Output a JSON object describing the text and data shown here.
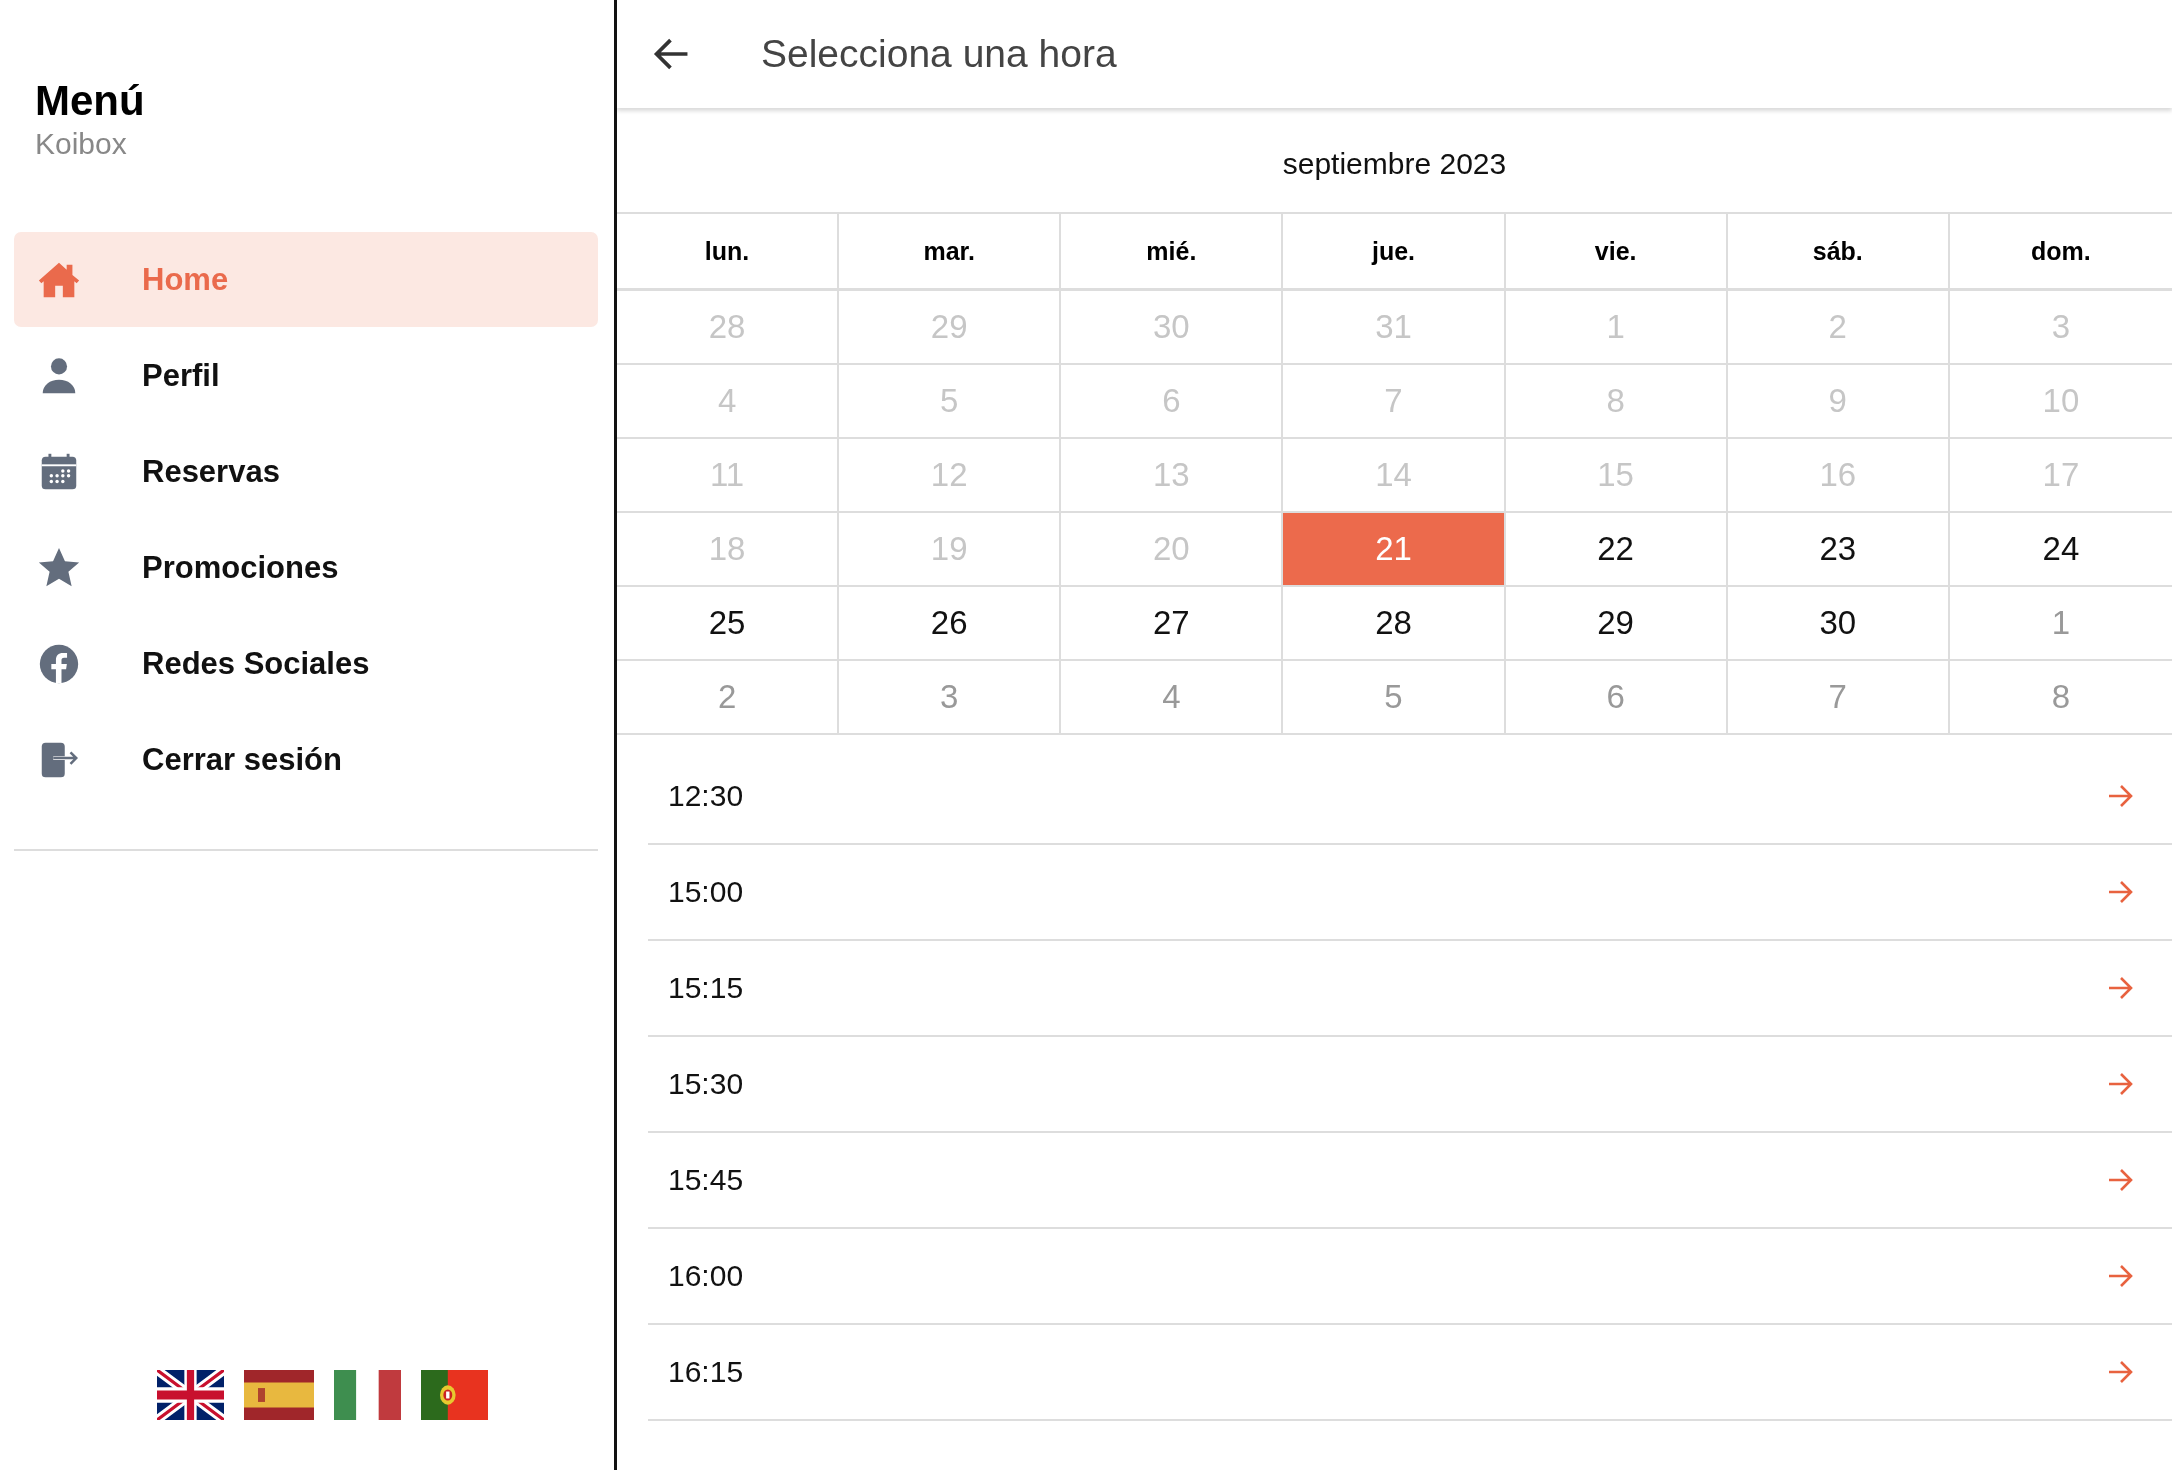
{
  "sidebar": {
    "title": "Menú",
    "subtitle": "Koibox",
    "items": [
      {
        "label": "Home",
        "selected": true
      },
      {
        "label": "Perfil",
        "selected": false
      },
      {
        "label": "Reservas",
        "selected": false
      },
      {
        "label": "Promociones",
        "selected": false
      },
      {
        "label": "Redes Sociales",
        "selected": false
      },
      {
        "label": "Cerrar sesión",
        "selected": false
      }
    ],
    "flags": [
      {
        "kind": "gb"
      },
      {
        "kind": "es"
      },
      {
        "kind": "it"
      },
      {
        "kind": "pt"
      }
    ]
  },
  "header": {
    "title": "Selecciona una hora"
  },
  "calendar": {
    "month": "septiembre 2023",
    "weekdays": [
      "lun.",
      "mar.",
      "mié.",
      "jue.",
      "vie.",
      "sáb.",
      "dom."
    ],
    "weeks": [
      [
        {
          "day": "28",
          "kind": "past",
          "selected": false
        },
        {
          "day": "29",
          "kind": "past",
          "selected": false
        },
        {
          "day": "30",
          "kind": "past",
          "selected": false
        },
        {
          "day": "31",
          "kind": "past",
          "selected": false
        },
        {
          "day": "1",
          "kind": "past",
          "selected": false
        },
        {
          "day": "2",
          "kind": "past",
          "selected": false
        },
        {
          "day": "3",
          "kind": "past",
          "selected": false
        }
      ],
      [
        {
          "day": "4",
          "kind": "past",
          "selected": false
        },
        {
          "day": "5",
          "kind": "past",
          "selected": false
        },
        {
          "day": "6",
          "kind": "past",
          "selected": false
        },
        {
          "day": "7",
          "kind": "past",
          "selected": false
        },
        {
          "day": "8",
          "kind": "past",
          "selected": false
        },
        {
          "day": "9",
          "kind": "past",
          "selected": false
        },
        {
          "day": "10",
          "kind": "past",
          "selected": false
        }
      ],
      [
        {
          "day": "11",
          "kind": "past",
          "selected": false
        },
        {
          "day": "12",
          "kind": "past",
          "selected": false
        },
        {
          "day": "13",
          "kind": "past",
          "selected": false
        },
        {
          "day": "14",
          "kind": "past",
          "selected": false
        },
        {
          "day": "15",
          "kind": "past",
          "selected": false
        },
        {
          "day": "16",
          "kind": "past",
          "selected": false
        },
        {
          "day": "17",
          "kind": "past",
          "selected": false
        }
      ],
      [
        {
          "day": "18",
          "kind": "past",
          "selected": false
        },
        {
          "day": "19",
          "kind": "past",
          "selected": false
        },
        {
          "day": "20",
          "kind": "past",
          "selected": false
        },
        {
          "day": "21",
          "kind": "available",
          "selected": true
        },
        {
          "day": "22",
          "kind": "available",
          "selected": false
        },
        {
          "day": "23",
          "kind": "available",
          "selected": false
        },
        {
          "day": "24",
          "kind": "available",
          "selected": false
        }
      ],
      [
        {
          "day": "25",
          "kind": "available",
          "selected": false
        },
        {
          "day": "26",
          "kind": "available",
          "selected": false
        },
        {
          "day": "27",
          "kind": "available",
          "selected": false
        },
        {
          "day": "28",
          "kind": "available",
          "selected": false
        },
        {
          "day": "29",
          "kind": "available",
          "selected": false
        },
        {
          "day": "30",
          "kind": "available",
          "selected": false
        },
        {
          "day": "1",
          "kind": "next",
          "selected": false
        }
      ],
      [
        {
          "day": "2",
          "kind": "next",
          "selected": false
        },
        {
          "day": "3",
          "kind": "next",
          "selected": false
        },
        {
          "day": "4",
          "kind": "next",
          "selected": false
        },
        {
          "day": "5",
          "kind": "next",
          "selected": false
        },
        {
          "day": "6",
          "kind": "next",
          "selected": false
        },
        {
          "day": "7",
          "kind": "next",
          "selected": false
        },
        {
          "day": "8",
          "kind": "next",
          "selected": false
        }
      ]
    ]
  },
  "times": [
    "12:30",
    "15:00",
    "15:15",
    "15:30",
    "15:45",
    "16:00",
    "16:15"
  ]
}
